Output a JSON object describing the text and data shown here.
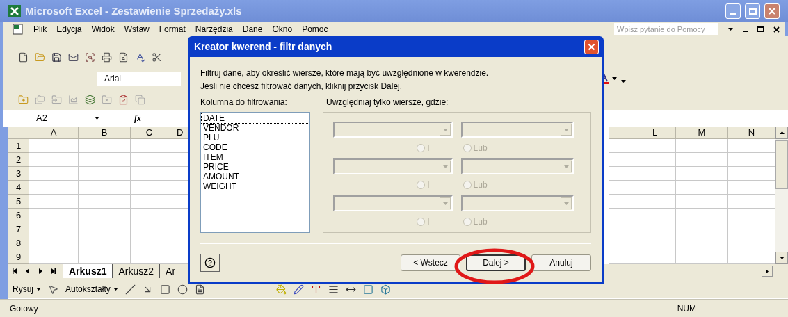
{
  "window": {
    "title": "Microsoft Excel - Zestawienie Sprzedaży.xls"
  },
  "menu_bar": {
    "items": [
      "Plik",
      "Edycja",
      "Widok",
      "Wstaw",
      "Format",
      "Narzędzia",
      "Dane",
      "Okno",
      "Pomoc"
    ],
    "help_placeholder": "Wpisz pytanie do Pomocy"
  },
  "formatting_toolbar": {
    "font": "Arial"
  },
  "formula_bar": {
    "name_box": "A2",
    "function_label": "fx"
  },
  "sheet": {
    "columns_left": [
      "A",
      "B",
      "C",
      "D"
    ],
    "columns_right": [
      "L",
      "M",
      "N"
    ],
    "rows": [
      "1",
      "2",
      "3",
      "4",
      "5",
      "6",
      "7",
      "8",
      "9"
    ]
  },
  "sheet_tabs": [
    {
      "label": "Arkusz1",
      "selected": true
    },
    {
      "label": "Arkusz2",
      "selected": false
    },
    {
      "label": "Ar",
      "selected": false
    }
  ],
  "drawing_toolbar": {
    "draw": "Rysuj",
    "autoshapes": "Autokształty"
  },
  "status_bar": {
    "status": "Gotowy",
    "num": "NUM"
  },
  "dialog": {
    "title": "Kreator kwerend - filtr danych",
    "intro": [
      "Filtruj dane, aby określić wiersze, które mają być uwzględnione w kwerendzie.",
      "Jeśli nie chcesz filtrować danych, kliknij przycisk Dalej."
    ],
    "column_label": "Kolumna do filtrowania:",
    "condition_label": "Uwzględniaj tylko wiersze, gdzie:",
    "columns": [
      {
        "label": "DATE",
        "selected": true
      },
      {
        "label": "VENDOR",
        "selected": false
      },
      {
        "label": "PLU",
        "selected": false
      },
      {
        "label": "CODE",
        "selected": false
      },
      {
        "label": "ITEM",
        "selected": false
      },
      {
        "label": "PRICE",
        "selected": false
      },
      {
        "label": "AMOUNT",
        "selected": false
      },
      {
        "label": "WEIGHT",
        "selected": false
      }
    ],
    "conditions": [
      {
        "and_label": "I",
        "and_selected": false,
        "or_label": "Lub",
        "or_selected": false,
        "disabled": true
      },
      {
        "and_label": "I",
        "and_selected": false,
        "or_label": "Lub",
        "or_selected": false,
        "disabled": true
      },
      {
        "and_label": "I",
        "and_selected": false,
        "or_label": "Lub",
        "or_selected": false,
        "disabled": true
      }
    ],
    "buttons": [
      {
        "label": "< Wstecz",
        "default": false,
        "circled": false
      },
      {
        "label": "Dalej >",
        "default": true,
        "circled": true
      },
      {
        "label": "Anuluj",
        "default": false,
        "circled": false
      }
    ]
  }
}
